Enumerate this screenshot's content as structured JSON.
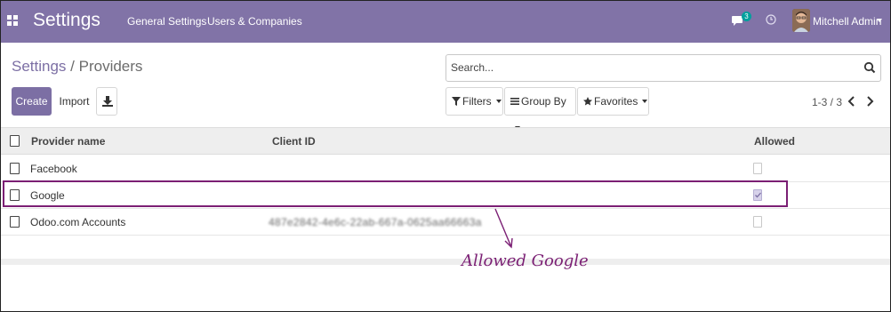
{
  "navbar": {
    "app_title": "Settings",
    "menu": [
      "General Settings",
      "Users & Companies"
    ],
    "chat_count": "3",
    "user_name": "Mitchell Admin",
    "color": "#8173a7"
  },
  "breadcrumb": {
    "parent": "Settings",
    "separator": " / ",
    "current": "Providers"
  },
  "search": {
    "placeholder": "Search..."
  },
  "toolbar": {
    "create_label": "Create",
    "import_label": "Import",
    "download_icon": "download-icon",
    "accent_color": "#7c6fa4"
  },
  "filters": {
    "filters_label": "Filters",
    "groupby_label": "Group By",
    "favorites_label": "Favorites"
  },
  "pager": {
    "value": "1-3 / 3"
  },
  "table": {
    "columns": [
      "Provider name",
      "Client ID",
      "Allowed"
    ],
    "rows": [
      {
        "provider": "Facebook",
        "client_id": "",
        "allowed": false
      },
      {
        "provider": "Google",
        "client_id": "",
        "allowed": true
      },
      {
        "provider": "Odoo.com Accounts",
        "client_id": "487e2842-4e6c-22ab-667a-0625aa66663a",
        "allowed": false
      }
    ]
  },
  "annotation": {
    "text": "Allowed Google",
    "color": "#7b1f74"
  }
}
